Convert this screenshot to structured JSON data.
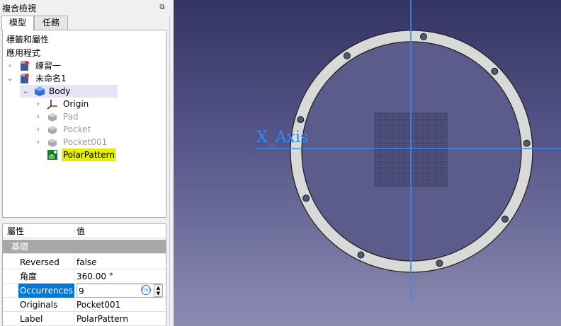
{
  "panel": {
    "title": "複合檢視",
    "float_button": "⧉",
    "tabs": [
      "模型",
      "任務"
    ]
  },
  "tree": {
    "header": "標籤和屬性",
    "app_label": "應用程式",
    "items": [
      {
        "label": "練習一",
        "icon": "document-icon",
        "expanded": false
      },
      {
        "label": "未命名1",
        "icon": "document-icon",
        "expanded": true
      },
      {
        "label": "Body",
        "icon": "body-icon",
        "expanded": true
      },
      {
        "label": "Origin",
        "icon": "origin-icon",
        "expanded": false
      },
      {
        "label": "Pad",
        "icon": "pad-icon",
        "hidden": true
      },
      {
        "label": "Pocket",
        "icon": "pocket-icon",
        "hidden": true
      },
      {
        "label": "Pocket001",
        "icon": "pocket-icon",
        "hidden": true
      },
      {
        "label": "PolarPattern",
        "icon": "polar-pattern-icon",
        "highlighted": true
      }
    ]
  },
  "properties": {
    "col_property": "屬性",
    "col_value": "值",
    "group": "基礎",
    "rows": [
      {
        "name": "Reversed",
        "value": "false"
      },
      {
        "name": "角度",
        "value": "360.00 °"
      },
      {
        "name": "Occurrences",
        "value": "9"
      },
      {
        "name": "Originals",
        "value": "Pocket001"
      },
      {
        "name": "Label",
        "value": "PolarPattern"
      }
    ]
  },
  "view": {
    "axis_label": "X_Axis",
    "axis_color": "#2e8cff",
    "ring_color": "#d9d9d9",
    "hole_count": 9
  }
}
